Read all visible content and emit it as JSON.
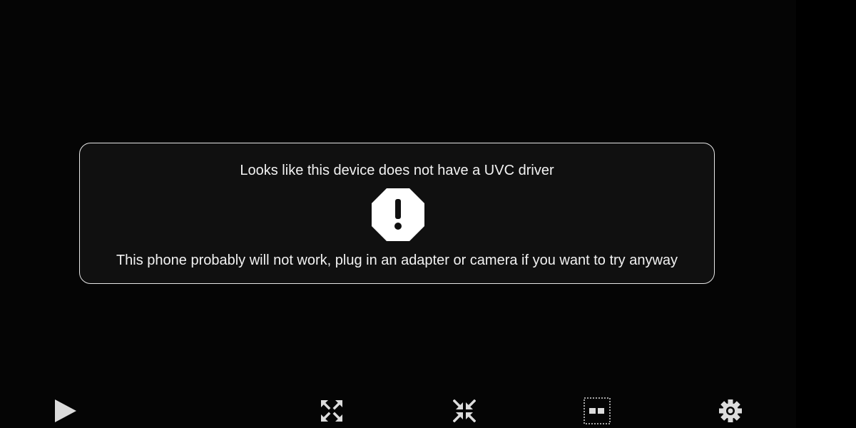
{
  "dialog": {
    "title": "Looks like this device does not have a UVC driver",
    "icon": "warning-octagon-icon",
    "message": "This phone probably will not work, plug in an adapter or camera if you want to try anyway"
  },
  "toolbar": {
    "buttons": [
      {
        "name": "play-button",
        "icon": "play-icon"
      },
      {
        "name": "expand-button",
        "icon": "expand-arrows-icon"
      },
      {
        "name": "shrink-button",
        "icon": "shrink-arrows-icon"
      },
      {
        "name": "aspect-button",
        "icon": "aspect-ratio-icon"
      },
      {
        "name": "settings-button",
        "icon": "gear-icon"
      }
    ]
  },
  "colors": {
    "background": "#050505",
    "dialog_background": "#101010",
    "dialog_border": "#e6e6e6",
    "text": "#f2f2f2",
    "icon": "#dcdcdc"
  }
}
